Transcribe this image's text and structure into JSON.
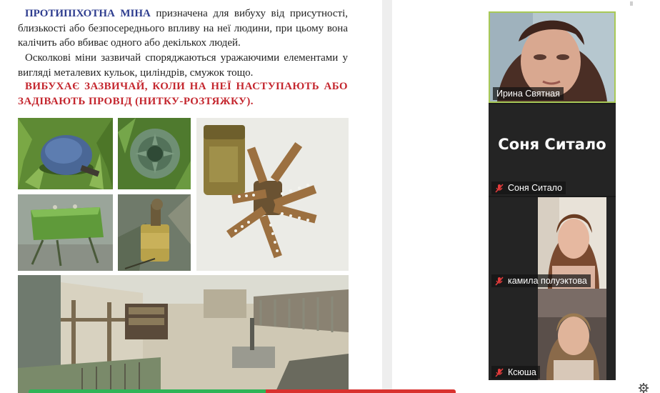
{
  "document": {
    "lead_term": "ПРОТИПІХОТНА МІНА",
    "para1": " призначена для вибуху від присутності, близькості або безпосереднього впливу на неї людини, при цьому вона калічить або вбиває одного або декількох людей.",
    "para2": "Осколкові міни зазвичай споряджаються уражаючими елементами у вигляді металевих кульок, циліндрів, смужок тощо.",
    "warning": "ВИБУХАЄ ЗАЗВИЧАЙ, КОЛИ НА НЕЇ НАСТУПАЮТЬ АБО ЗАДІВАЮТЬ ПРОВІД (НИТКУ-РОЗТЯЖКУ)."
  },
  "participants": [
    {
      "name": "Ирина Святная",
      "muted": false,
      "active_speaker": true,
      "video": true
    },
    {
      "name": "Соня Ситало",
      "muted": true,
      "active_speaker": false,
      "video": false
    },
    {
      "name": "камила полуэктова",
      "muted": true,
      "active_speaker": false,
      "video": true
    },
    {
      "name": "Ксюша",
      "muted": true,
      "active_speaker": false,
      "video": true
    }
  ],
  "icons": {
    "mute": "mic-muted-icon",
    "settings": "gear-icon"
  },
  "colors": {
    "lead_blue": "#2e3d8f",
    "warning_red": "#c4262e",
    "speaker_border": "#a8c957",
    "mute_red": "#e23b3b",
    "bar_green": "#2fb457",
    "bar_red": "#d9322f"
  }
}
